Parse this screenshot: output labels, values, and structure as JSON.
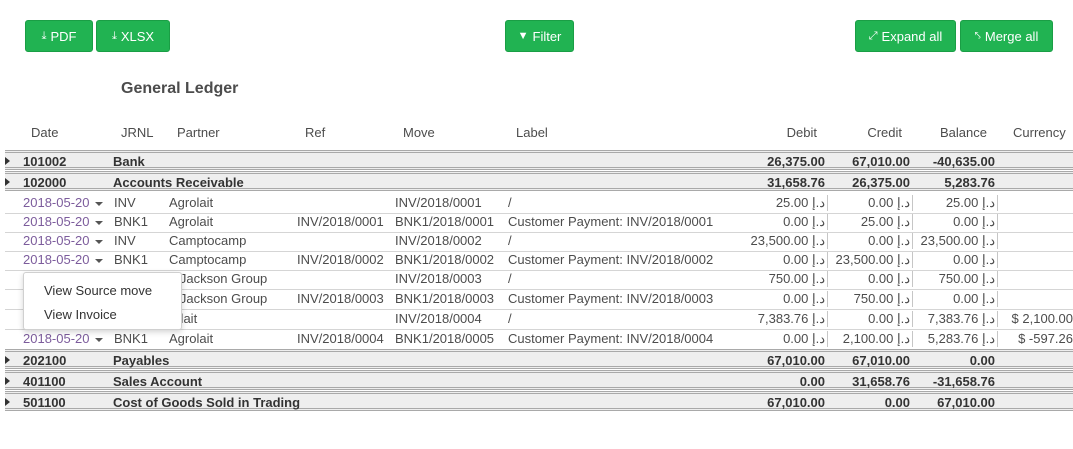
{
  "toolbar": {
    "pdf": "PDF",
    "xlsx": "XLSX",
    "filter": "Filter",
    "expand_all": "Expand all",
    "merge_all": "Merge all"
  },
  "report_title": "General Ledger",
  "columns": {
    "date": "Date",
    "jrnl": "JRNL",
    "partner": "Partner",
    "ref": "Ref",
    "move": "Move",
    "label": "Label",
    "debit": "Debit",
    "credit": "Credit",
    "balance": "Balance",
    "currency": "Currency"
  },
  "accounts": [
    {
      "code": "101002",
      "name": "Bank",
      "debit": "26,375.00",
      "credit": "67,010.00",
      "balance": "-40,635.00"
    },
    {
      "code": "102000",
      "name": "Accounts Receivable",
      "debit": "31,658.76",
      "credit": "26,375.00",
      "balance": "5,283.76"
    },
    {
      "code": "202100",
      "name": "Payables",
      "debit": "67,010.00",
      "credit": "67,010.00",
      "balance": "0.00"
    },
    {
      "code": "401100",
      "name": "Sales Account",
      "debit": "0.00",
      "credit": "31,658.76",
      "balance": "-31,658.76"
    },
    {
      "code": "501100",
      "name": "Cost of Goods Sold in Trading",
      "debit": "67,010.00",
      "credit": "0.00",
      "balance": "67,010.00"
    }
  ],
  "move_lines": [
    {
      "date": "2018-05-20",
      "jrnl": "INV",
      "partner": "Agrolait",
      "ref": "",
      "move": "INV/2018/0001",
      "label": "/",
      "debit": "25.00 د.إ",
      "credit": "0.00 د.إ",
      "balance": "25.00 د.إ",
      "currency": ""
    },
    {
      "date": "2018-05-20",
      "jrnl": "BNK1",
      "partner": "Agrolait",
      "ref": "INV/2018/0001",
      "move": "BNK1/2018/0001",
      "label": "Customer Payment: INV/2018/0001",
      "debit": "0.00 د.إ",
      "credit": "25.00 د.إ",
      "balance": "0.00 د.إ",
      "currency": ""
    },
    {
      "date": "2018-05-20",
      "jrnl": "INV",
      "partner": "Camptocamp",
      "ref": "",
      "move": "INV/2018/0002",
      "label": "/",
      "debit": "23,500.00 د.إ",
      "credit": "0.00 د.إ",
      "balance": "23,500.00 د.إ",
      "currency": ""
    },
    {
      "date": "2018-05-20",
      "jrnl": "BNK1",
      "partner": "Camptocamp",
      "ref": "INV/2018/0002",
      "move": "BNK1/2018/0002",
      "label": "Customer Payment: INV/2018/0002",
      "debit": "0.00 د.إ",
      "credit": "23,500.00 د.إ",
      "balance": "0.00 د.إ",
      "currency": ""
    },
    {
      "date": "",
      "jrnl": "",
      "partner": "e Jackson Group",
      "ref": "",
      "move": "INV/2018/0003",
      "label": "/",
      "debit": "750.00 د.إ",
      "credit": "0.00 د.إ",
      "balance": "750.00 د.إ",
      "currency": ""
    },
    {
      "date": "",
      "jrnl": "",
      "partner": "e Jackson Group",
      "ref": "INV/2018/0003",
      "move": "BNK1/2018/0003",
      "label": "Customer Payment: INV/2018/0003",
      "debit": "0.00 د.إ",
      "credit": "750.00 د.إ",
      "balance": "0.00 د.إ",
      "currency": ""
    },
    {
      "date": "",
      "jrnl": "",
      "partner": "rolait",
      "ref": "",
      "move": "INV/2018/0004",
      "label": "/",
      "debit": "7,383.76 د.إ",
      "credit": "0.00 د.إ",
      "balance": "7,383.76 د.إ",
      "currency": "$ 2,100.00"
    },
    {
      "date": "2018-05-20",
      "jrnl": "BNK1",
      "partner": "Agrolait",
      "ref": "INV/2018/0004",
      "move": "BNK1/2018/0005",
      "label": "Customer Payment: INV/2018/0004",
      "debit": "0.00 د.إ",
      "credit": "2,100.00 د.إ",
      "balance": "5,283.76 د.إ",
      "currency": "$ -597.26"
    }
  ],
  "dropdown": {
    "view_source_move": "View Source move",
    "view_invoice": "View Invoice"
  },
  "colors": {
    "button_green": "#21b352",
    "date_link": "#7c5c9c",
    "account_row_bg": "#eeeeee"
  }
}
